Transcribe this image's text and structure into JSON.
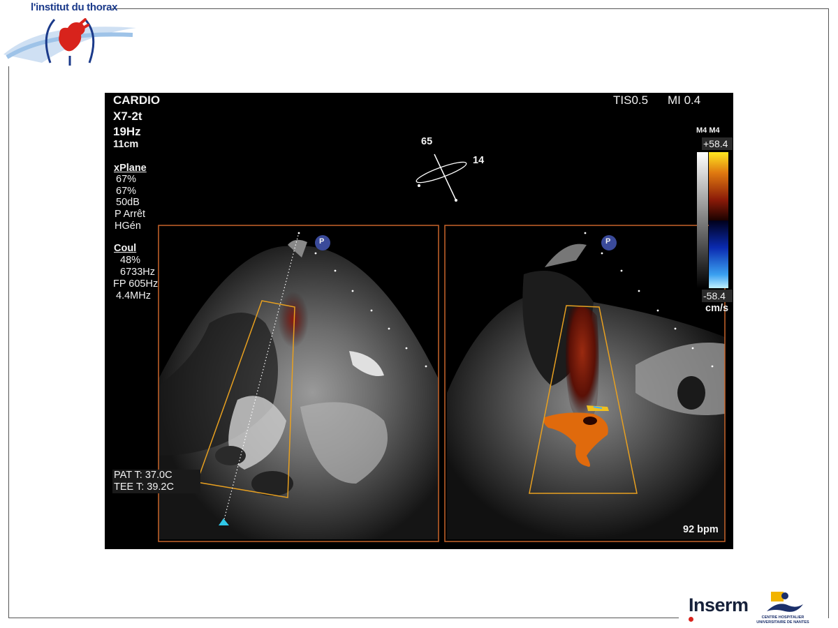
{
  "header": {
    "brand": "l'institut du thorax"
  },
  "ultrasound": {
    "top_left": {
      "mode": "CARDIO",
      "probe": "X7-2t",
      "frame_rate": "19Hz",
      "depth": "11cm"
    },
    "xplane": {
      "heading": "xPlane",
      "lines": [
        "67%",
        "67%",
        "50dB",
        "P Arrêt",
        "HGén"
      ]
    },
    "color": {
      "heading": "Coul",
      "lines": [
        "48%",
        "6733Hz",
        "FP 605Hz",
        "4.4MHz"
      ]
    },
    "top_right": {
      "tis": "TIS0.5",
      "mi": "MI 0.4"
    },
    "angle_indicator": {
      "primary": "65",
      "secondary": "14"
    },
    "color_bar": {
      "label": "M4 M4",
      "max": "+58.4",
      "min": "-58.4",
      "unit": "cm/s"
    },
    "temperatures": {
      "patient": "PAT T: 37.0C",
      "probe": "TEE T: 39.2C"
    },
    "heart_rate": "92 bpm",
    "plane_marker": "P"
  },
  "footer": {
    "inserm": "Inserm",
    "chu_line1": "CENTRE HOSPITALIER",
    "chu_line2": "UNIVERSITAIRE DE NANTES"
  },
  "colors": {
    "frame_orange": "#c8642a",
    "brand_blue": "#1b3a8a",
    "logo_red": "#d8231c"
  }
}
